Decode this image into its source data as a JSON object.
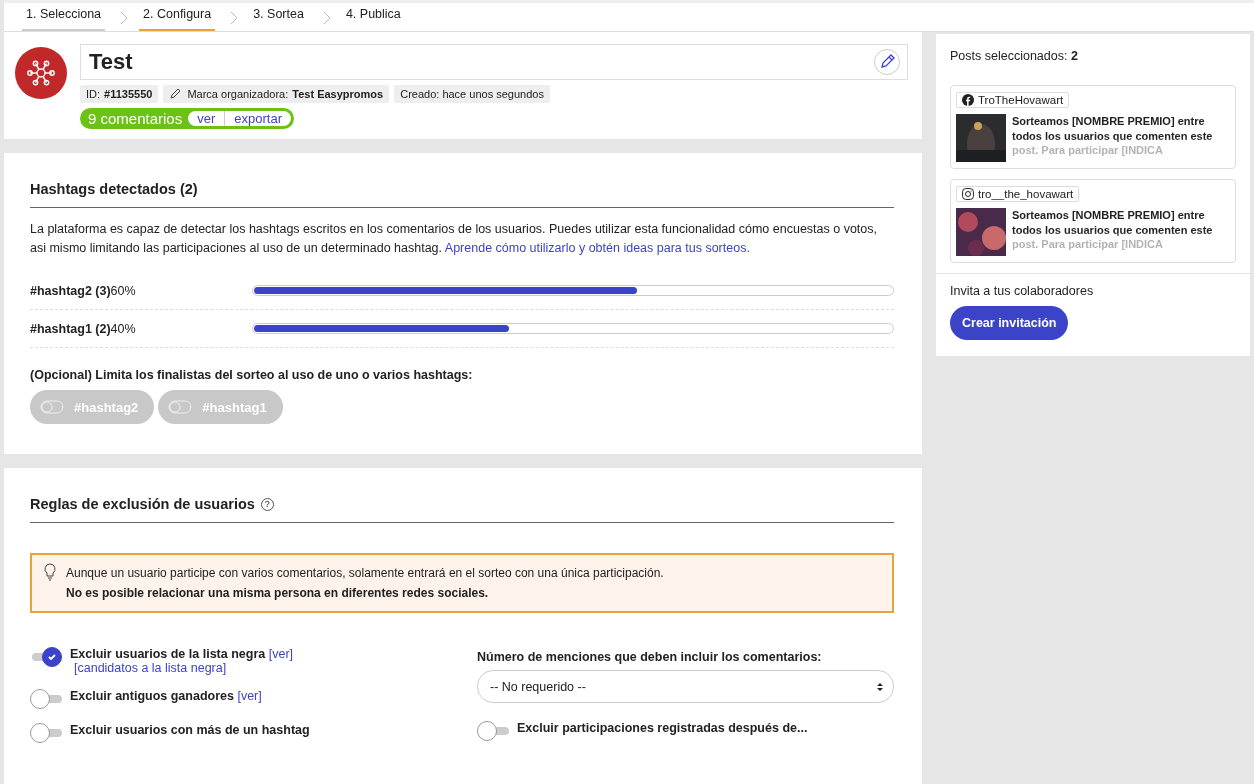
{
  "steps": [
    {
      "label": "1. Selecciona",
      "selected": false,
      "done": true
    },
    {
      "label": "2. Configura",
      "selected": true,
      "done": false
    },
    {
      "label": "3. Sortea",
      "selected": false,
      "done": false
    },
    {
      "label": "4. Publica",
      "selected": false,
      "done": false
    }
  ],
  "promotion": {
    "title": "Test",
    "id_label": "ID:",
    "id": "#1135550",
    "brand_label": "Marca organizadora:",
    "brand": "Test Easypromos",
    "created": "Creado: hace unos segundos",
    "comments": "9 comentarios",
    "view_link": "ver",
    "export_link": "exportar"
  },
  "hashtags": {
    "title": "Hashtags detectados (2)",
    "description": "La plataforma es capaz de detectar los hashtags escritos en los comentarios de los usuarios. Puedes utilizar esta funcionalidad cómo encuestas o votos, asi mismo limitando las participaciones al uso de un determinado hashtag.",
    "link": "Aprende cómo utilizarlo y obtén ideas para tus sorteos.",
    "rows": [
      {
        "name": "#hashtag2 (3)",
        "percent": "60%",
        "level": 0.6
      },
      {
        "name": "#hashtag1 (2)",
        "percent": "40%",
        "level": 0.4
      }
    ],
    "filter_label": "(Opcional) Limita los finalistas del sorteo al uso de uno o varios hashtags:",
    "filters": [
      {
        "label": "#hashtag2",
        "on": false
      },
      {
        "label": "#hashtag1",
        "on": false
      }
    ]
  },
  "rules": {
    "title": "Reglas de exclusión de usuarios",
    "help": "?",
    "notice": "Aunque un usuario participe con varios comentarios, solamente entrará en el sorteo con una única participación.",
    "notice_bold": "No es posible relacionar una misma persona en diferentes redes sociales.",
    "left": [
      {
        "label": "Excluir usuarios de la lista negra",
        "on": true,
        "link": "[ver]",
        "sublink": "[candidatos a la lista negra]"
      },
      {
        "label": "Excluir antiguos ganadores",
        "on": false,
        "link": "[ver]"
      },
      {
        "label": "Excluir usuarios con más de un hashtag",
        "on": false
      }
    ],
    "mentions_label": "Número de menciones que deben incluir los comentarios:",
    "mentions_value": "-- No requerido --",
    "right": [
      {
        "label": "Excluir participaciones registradas después de...",
        "on": false
      }
    ]
  },
  "sidebar": {
    "posts_label": "Posts seleccionados:",
    "posts_count": "2",
    "posts": [
      {
        "kind": "facebook",
        "account": "TroTheHovawart",
        "text": "Sorteamos [NOMBRE PREMIO] entre todos los usuarios que comenten este post. Para participar [INDICA"
      },
      {
        "kind": "instagram",
        "account": "tro__the_hovawart",
        "text": "Sorteamos [NOMBRE PREMIO] entre todos los usuarios que comenten este post. Para participar [INDICA"
      }
    ],
    "invite_label": "Invita a tus colaboradores",
    "invite_button": "Crear invitación"
  }
}
